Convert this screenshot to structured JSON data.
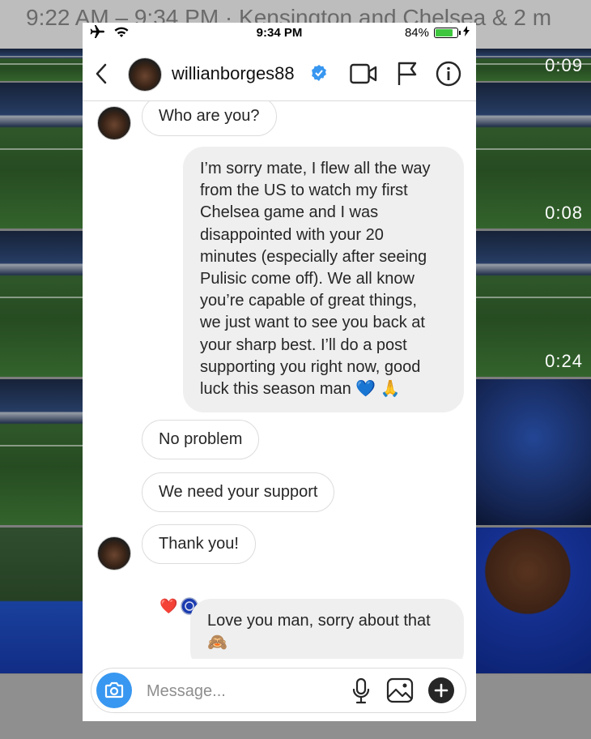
{
  "background": {
    "header_text": "9:22 AM – 9:34 PM  ·  Kensington and Chelsea & 2 m",
    "durations": [
      "0:09",
      "0:08",
      "0:24"
    ]
  },
  "status_bar": {
    "time": "9:34 PM",
    "battery_percent": "84%",
    "battery_level": 0.84
  },
  "header": {
    "username": "willianborges88",
    "verified": true,
    "icons": [
      "back-icon",
      "video-call-icon",
      "flag-icon",
      "info-icon"
    ]
  },
  "thread": {
    "messages": [
      {
        "from": "them",
        "text": "Who are you?"
      },
      {
        "from": "me",
        "lines": [
          "I’m sorry mate, I flew all the way",
          "from the US to watch my first",
          "Chelsea game and I was",
          "disappointed with your 20",
          "minutes (especially after seeing",
          "Pulisic come off). We all know",
          "you’re capable of great things,",
          "we just want to see you back at",
          "your sharp best. I’ll do a post",
          "supporting you right now, good",
          "luck this season man 💙 🙏"
        ]
      },
      {
        "from": "them",
        "text": "No problem"
      },
      {
        "from": "them",
        "text": "We need your support"
      },
      {
        "from": "them",
        "text": "Thank you!",
        "reactions": [
          "❤️",
          "🔵"
        ]
      },
      {
        "from": "me",
        "lines": [
          "Love you man, sorry about that",
          "🙈"
        ]
      }
    ]
  },
  "composer": {
    "placeholder": "Message..."
  },
  "colors": {
    "accent": "#3897f0",
    "bubble_out": "#efefef",
    "verified": "#3897f0",
    "battery": "#3ec73e"
  }
}
